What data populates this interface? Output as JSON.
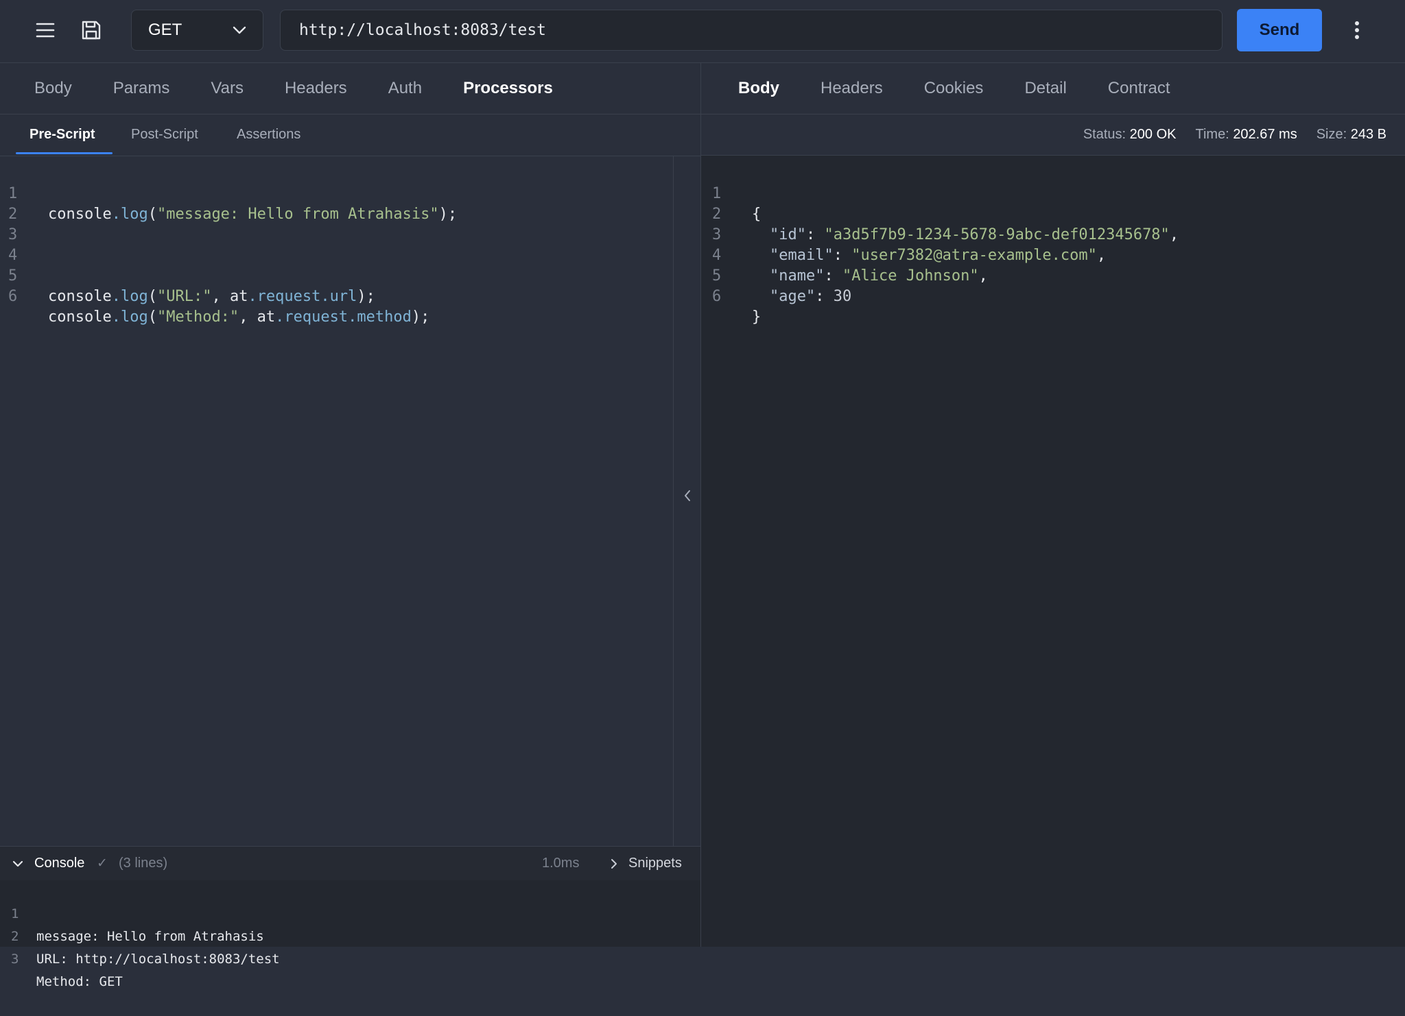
{
  "toolbar": {
    "method": "GET",
    "url": "http://localhost:8083/test",
    "send_label": "Send"
  },
  "request_tabs": [
    "Body",
    "Params",
    "Vars",
    "Headers",
    "Auth",
    "Processors"
  ],
  "request_active_tab": "Processors",
  "processor_tabs": [
    "Pre-Script",
    "Post-Script",
    "Assertions"
  ],
  "processor_active_tab": "Pre-Script",
  "editor": {
    "line_numbers": [
      "1",
      "2",
      "3",
      "4",
      "5",
      "6"
    ],
    "line1": {
      "obj": "console",
      "dot": ".",
      "fn": "log",
      "open": "(",
      "str": "\"message: Hello from Atrahasis\"",
      "close": ");"
    },
    "line5": {
      "obj": "console",
      "dot": ".",
      "fn": "log",
      "open": "(",
      "str": "\"URL:\"",
      "mid": ", at",
      "prop": ".request.url",
      "close": ");"
    },
    "line6": {
      "obj": "console",
      "dot": ".",
      "fn": "log",
      "open": "(",
      "str": "\"Method:\"",
      "mid": ", at",
      "prop": ".request.method",
      "close": ");"
    }
  },
  "console": {
    "title": "Console",
    "check": "✓",
    "count": "(3 lines)",
    "time": "1.0ms",
    "snippets_label": "Snippets",
    "lines": [
      {
        "n": "1",
        "text": "message: Hello from Atrahasis"
      },
      {
        "n": "2",
        "text": "URL: http://localhost:8083/test"
      },
      {
        "n": "3",
        "text": "Method: GET"
      }
    ]
  },
  "response_tabs": [
    "Body",
    "Headers",
    "Cookies",
    "Detail",
    "Contract"
  ],
  "response_active_tab": "Body",
  "response_status": {
    "status_label": "Status:",
    "status_value": "200 OK",
    "time_label": "Time:",
    "time_value": "202.67 ms",
    "size_label": "Size:",
    "size_value": "243 B"
  },
  "response_body": {
    "line_numbers": [
      "1",
      "2",
      "3",
      "4",
      "5",
      "6"
    ],
    "open_brace": "{",
    "close_brace": "}",
    "fields": [
      {
        "key": "\"id\"",
        "value": "\"a3d5f7b9-1234-5678-9abc-def012345678\"",
        "comma": ","
      },
      {
        "key": "\"email\"",
        "value": "\"user7382@atra-example.com\"",
        "comma": ","
      },
      {
        "key": "\"name\"",
        "value": "\"Alice Johnson\"",
        "comma": ","
      },
      {
        "key": "\"age\"",
        "value": "30",
        "comma": ""
      }
    ]
  },
  "colors": {
    "accent": "#3b82f6",
    "background": "#2a2f3b",
    "panel": "#23272f"
  }
}
